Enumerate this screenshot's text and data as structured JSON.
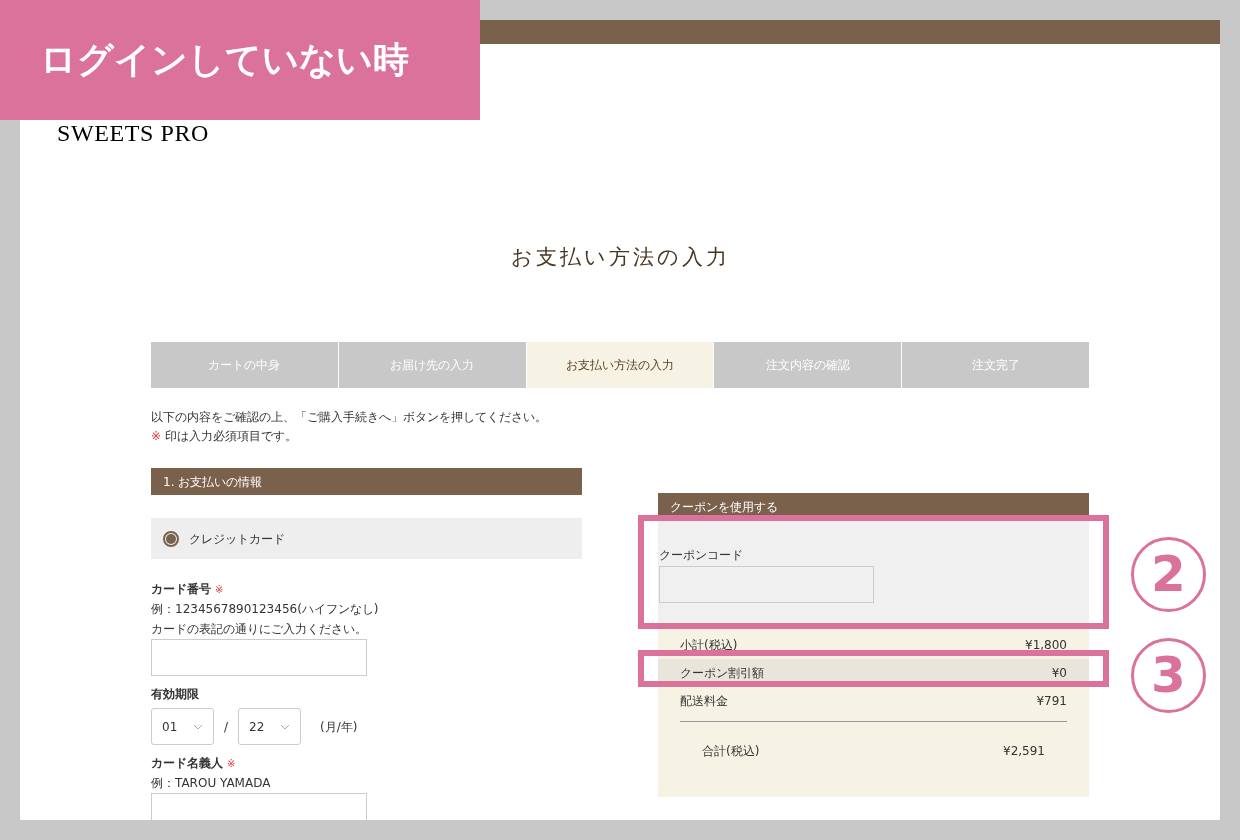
{
  "annotation": {
    "label": "ログインしていない時",
    "callouts": [
      {
        "number": "2"
      },
      {
        "number": "3"
      }
    ]
  },
  "header": {
    "logo": "SWEETS PRO"
  },
  "page_title": "お支払い方法の入力",
  "steps": [
    {
      "label": "カートの中身",
      "selected": false
    },
    {
      "label": "お届け先の入力",
      "selected": false
    },
    {
      "label": "お支払い方法の入力",
      "selected": true
    },
    {
      "label": "注文内容の確認",
      "selected": false
    },
    {
      "label": "注文完了",
      "selected": false
    }
  ],
  "instructions": {
    "line": "以下の内容をご確認の上、「ご購入手続きへ」ボタンを押してください。",
    "required_mark": "※",
    "required_note": "印は入力必須項目です。"
  },
  "payment": {
    "heading": "1. お支払いの情報",
    "method": {
      "label": "クレジットカード",
      "selected": true
    },
    "card_number": {
      "label": "カード番号",
      "required_mark": "※",
      "hints": [
        "例：1234567890123456(ハイフンなし)",
        "カードの表記の通りにご入力ください。"
      ]
    },
    "expiry": {
      "label": "有効期限",
      "month": "01",
      "separator": "/",
      "year": "22",
      "format": "(月/年)"
    },
    "card_holder": {
      "label": "カード名義人",
      "required_mark": "※",
      "hints": [
        "例：TAROU YAMADA"
      ]
    }
  },
  "coupon": {
    "heading": "クーポンを使用する",
    "code_label": "クーポンコード"
  },
  "summary": [
    {
      "label": "小計(税込)",
      "amount": "¥1,800",
      "kind": "line",
      "highlighted": false
    },
    {
      "label": "クーポン割引額",
      "amount": "¥0",
      "kind": "line",
      "highlighted": true
    },
    {
      "label": "配送料金",
      "amount": "¥791",
      "kind": "line",
      "highlighted": false
    },
    {
      "label": "合計(税込)",
      "amount": "¥2,591",
      "kind": "total",
      "highlighted": false
    }
  ]
}
